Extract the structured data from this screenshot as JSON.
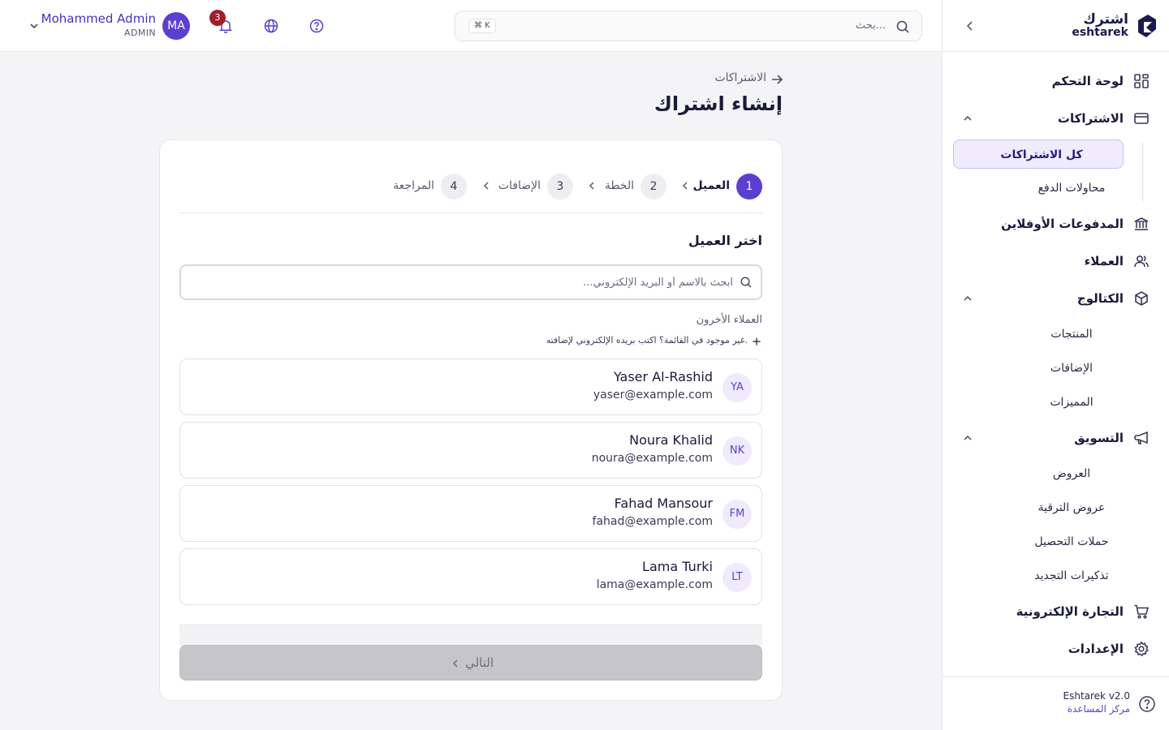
{
  "brand": {
    "name_ar": "اشترك",
    "name_en": "eshtarek",
    "color": "#1a1a4b"
  },
  "topbar": {
    "search_placeholder": "بحث...",
    "shortcut": "⌘ K",
    "notifications_count": "3",
    "user": {
      "name": "Mohammed Admin",
      "role": "ADMIN",
      "initials": "MA"
    }
  },
  "sidebar": {
    "items": {
      "dashboard": "لوحة التحكم",
      "subscriptions": "الاشتراكات",
      "all_subscriptions": "كل الاشتراكات",
      "payment_attempts": "محاولات الدفع",
      "offline_payments": "المدفوعات الأوفلاين",
      "customers": "العملاء",
      "catalog": "الكتالوج",
      "products": "المنتجات",
      "addons": "الإضافات",
      "features": "المميزات",
      "marketing": "التسويق",
      "offers": "العروض",
      "upgrade_offers": "عروض الترقية",
      "collection_campaigns": "حملات التحصيل",
      "renewal_reminders": "تذكيرات التجديد",
      "ecommerce": "التجارة الإلكترونية",
      "settings": "الإعدادات"
    },
    "footer": {
      "version": "Eshtarek v2.0",
      "help": "مركز المساعدة"
    }
  },
  "page": {
    "back_label": "الاشتراكات",
    "title": "إنشاء اشتراك"
  },
  "stepper": {
    "steps": [
      {
        "num": "1",
        "label": "العميل"
      },
      {
        "num": "2",
        "label": "الخطة"
      },
      {
        "num": "3",
        "label": "الإضافات"
      },
      {
        "num": "4",
        "label": "المراجعة"
      }
    ]
  },
  "customer_step": {
    "title": "اختر العميل",
    "search_placeholder": "ابحث بالاسم أو البريد الإلكتروني...",
    "others_label": "العملاء الأخرون",
    "add_note": "غير موجود في القائمة؟ اكتب بريده الإلكتروني لإضافته.",
    "customers": [
      {
        "initials": "YA",
        "name": "Yaser Al-Rashid",
        "email": "yaser@example.com"
      },
      {
        "initials": "NK",
        "name": "Noura Khalid",
        "email": "noura@example.com"
      },
      {
        "initials": "FM",
        "name": "Fahad Mansour",
        "email": "fahad@example.com"
      },
      {
        "initials": "LT",
        "name": "Lama Turki",
        "email": "lama@example.com"
      }
    ],
    "next_label": "التالي"
  },
  "colors": {
    "accent": "#5b3fd0",
    "badge": "#a11d2a"
  }
}
